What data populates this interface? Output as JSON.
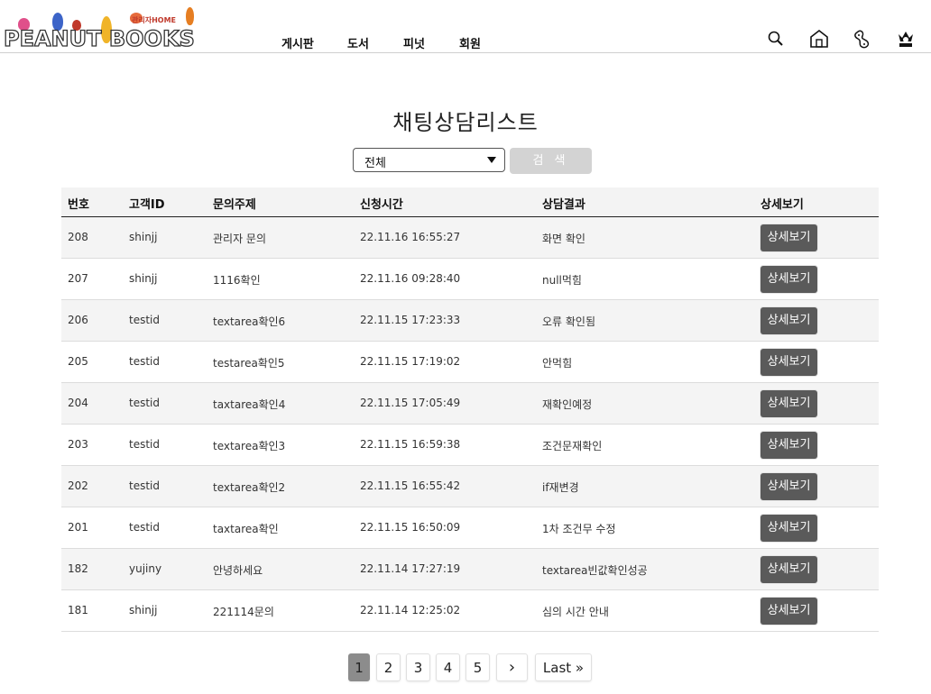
{
  "header": {
    "logo_text": "PEANUT BOOKS",
    "logo_sub": "관리자HOME",
    "nav": [
      "게시판",
      "도서",
      "피넛",
      "회원"
    ],
    "icons": [
      "search-icon",
      "home-icon",
      "peanut-icon",
      "admin-crown-icon"
    ]
  },
  "page": {
    "title": "채팅상담리스트",
    "filter_value": "전체",
    "search_label": "검 색"
  },
  "table": {
    "headers": [
      "번호",
      "고객ID",
      "문의주제",
      "신청시간",
      "상담결과",
      "상세보기"
    ],
    "detail_label": "상세보기",
    "rows": [
      [
        "208",
        "shinjj",
        "관리자 문의",
        "22.11.16 16:55:27",
        "화면 확인"
      ],
      [
        "207",
        "shinjj",
        "1116확인",
        "22.11.16 09:28:40",
        "null먹힘"
      ],
      [
        "206",
        "testid",
        "textarea확인6",
        "22.11.15 17:23:33",
        "오류 확인됨"
      ],
      [
        "205",
        "testid",
        "testarea확인5",
        "22.11.15 17:19:02",
        "안먹힘"
      ],
      [
        "204",
        "testid",
        "taxtarea확인4",
        "22.11.15 17:05:49",
        "재확인예정"
      ],
      [
        "203",
        "testid",
        "textarea확인3",
        "22.11.15 16:59:38",
        "조건문재확인"
      ],
      [
        "202",
        "testid",
        "textarea확인2",
        "22.11.15 16:55:42",
        "if재변경"
      ],
      [
        "201",
        "testid",
        "taxtarea확인",
        "22.11.15 16:50:09",
        "1차 조건무 수정"
      ],
      [
        "182",
        "yujiny",
        "안녕하세요",
        "22.11.14 17:27:19",
        "textarea빈값확인성공"
      ],
      [
        "181",
        "shinjj",
        "221114문의",
        "22.11.14 12:25:02",
        "심의 시간 안내"
      ]
    ]
  },
  "pagination": {
    "pages": [
      "1",
      "2",
      "3",
      "4",
      "5"
    ],
    "active": "1",
    "next": "›",
    "last": "Last »"
  },
  "colors": {
    "detail_button": "#5a5a5a",
    "search_button": "#d3d3d3",
    "active_page": "#8c8c8c"
  }
}
